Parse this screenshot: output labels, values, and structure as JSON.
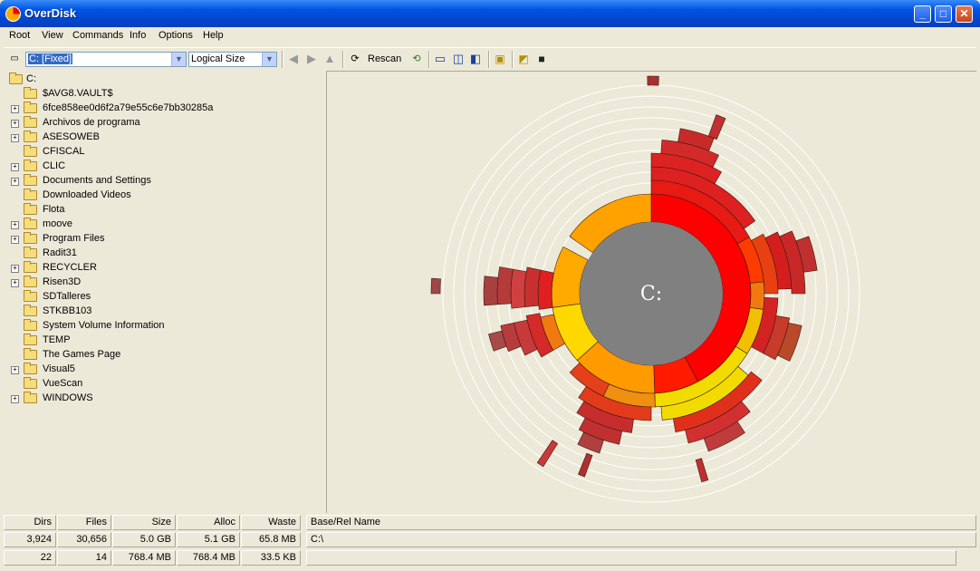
{
  "window": {
    "title": "OverDisk"
  },
  "menu": [
    "Root",
    "View",
    "Commands",
    "Info",
    "Options",
    "Help"
  ],
  "toolbar": {
    "drive": "C: [Fixed]",
    "size_mode": "Logical Size",
    "rescan_label": "Rescan"
  },
  "tree": {
    "root": "C:",
    "items": [
      {
        "name": "$AVG8.VAULT$",
        "expandable": false
      },
      {
        "name": "6fce858ee0d6f2a79e55c6e7bb30285a",
        "expandable": true
      },
      {
        "name": "Archivos de programa",
        "expandable": true
      },
      {
        "name": "ASESOWEB",
        "expandable": true
      },
      {
        "name": "CFISCAL",
        "expandable": false
      },
      {
        "name": "CLIC",
        "expandable": true
      },
      {
        "name": "Documents and Settings",
        "expandable": true
      },
      {
        "name": "Downloaded Videos",
        "expandable": false
      },
      {
        "name": "Flota",
        "expandable": false
      },
      {
        "name": "moove",
        "expandable": true
      },
      {
        "name": "Program Files",
        "expandable": true
      },
      {
        "name": "Radit31",
        "expandable": false
      },
      {
        "name": "RECYCLER",
        "expandable": true
      },
      {
        "name": "Risen3D",
        "expandable": true
      },
      {
        "name": "SDTalleres",
        "expandable": false
      },
      {
        "name": "STKBB103",
        "expandable": false
      },
      {
        "name": "System Volume Information",
        "expandable": false
      },
      {
        "name": "TEMP",
        "expandable": false
      },
      {
        "name": "The Games Page",
        "expandable": false
      },
      {
        "name": "Visual5",
        "expandable": true
      },
      {
        "name": "VueScan",
        "expandable": false
      },
      {
        "name": "WINDOWS",
        "expandable": true
      }
    ]
  },
  "chart": {
    "center_label": "C:"
  },
  "status": {
    "headers": [
      "Dirs",
      "Files",
      "Size",
      "Alloc",
      "Waste",
      "Base/Rel Name"
    ],
    "rows": [
      [
        "3,924",
        "30,656",
        "5.0 GB",
        "5.1 GB",
        "65.8 MB",
        "C:\\"
      ],
      [
        "22",
        "14",
        "768.4 MB",
        "768.4 MB",
        "33.5 KB",
        ""
      ]
    ]
  },
  "colors": {
    "titlebar": "#0054e3",
    "center": "#808080",
    "ring_red": "#ff0000",
    "ring_orange": "#ffa500",
    "ring_yellow": "#f2dc00"
  }
}
